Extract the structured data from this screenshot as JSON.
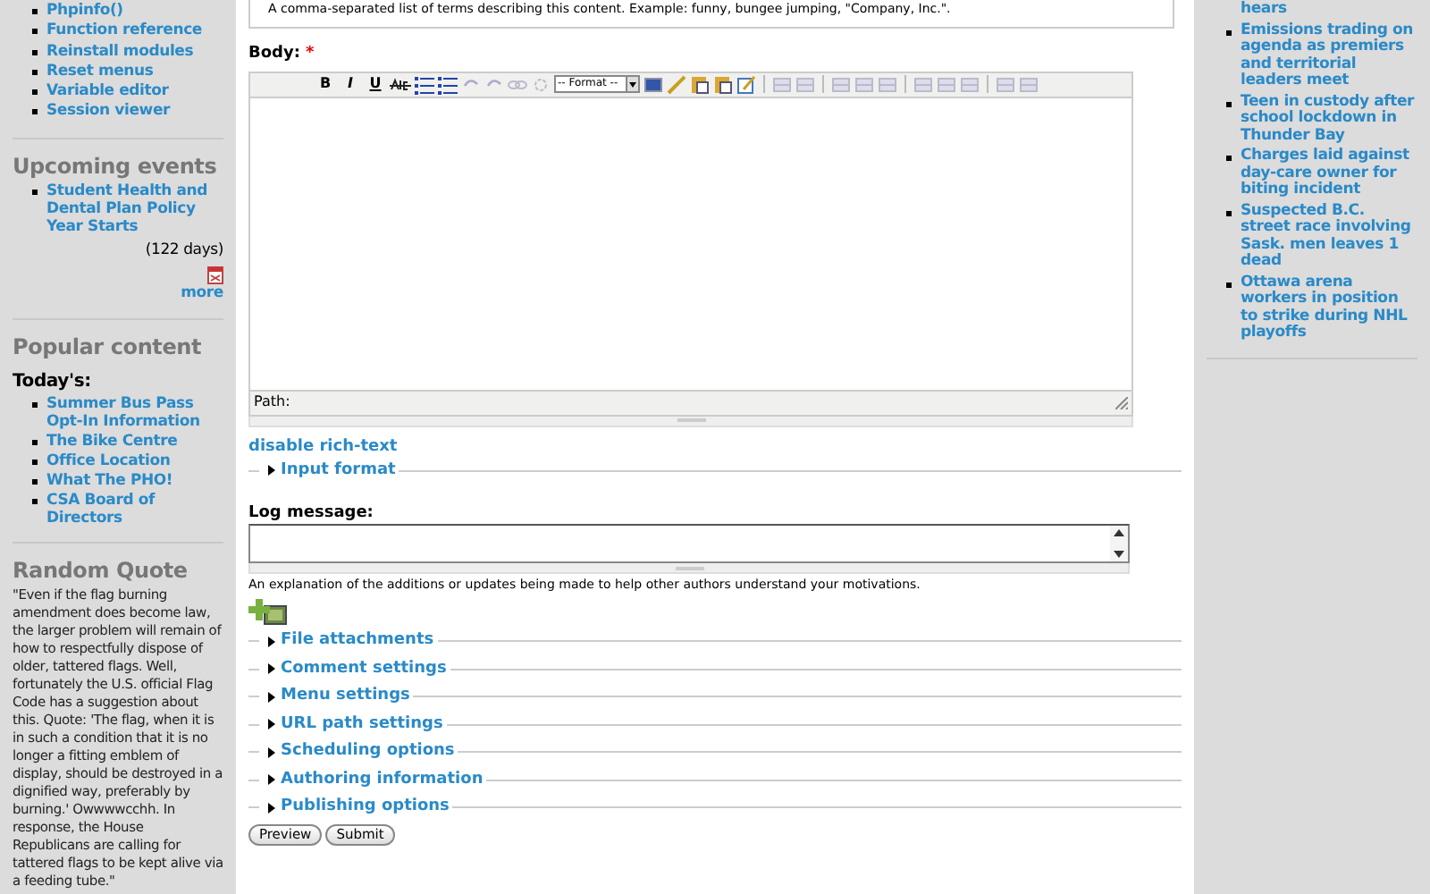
{
  "left_sidebar": {
    "admin_links": [
      "Phpinfo()",
      "Function reference",
      "Reinstall modules",
      "Reset menus",
      "Variable editor",
      "Session viewer"
    ],
    "upcoming_events": {
      "title": "Upcoming events",
      "events": [
        {
          "label": "Student Health and Dental Plan Policy Year Starts",
          "days": "(122 days)"
        }
      ],
      "more": "more"
    },
    "popular_content": {
      "title": "Popular content",
      "subtitle": "Today's:",
      "items": [
        "Summer Bus Pass Opt-In Information",
        "The Bike Centre",
        "Office Location",
        "What The PHO!",
        "CSA Board of Directors"
      ]
    },
    "random_quote": {
      "title": "Random Quote",
      "text": "\"Even if the flag burning amendment does become law, the larger problem will remain of how to respectfully dispose of older, tattered flags. Well, fortunately the U.S. official Flag Code has a suggestion about this. Quote: 'The flag, when it is in such a condition that it is no longer a fitting emblem of display, should be destroyed in a dignified way, preferably by burning.' Owwwwcchh. In response, the House Republicans are calling for tattered flags to be kept alive via a feeding tube.\""
    }
  },
  "main": {
    "tags_description": "A comma-separated list of terms describing this content. Example: funny, bungee jumping, \"Company, Inc.\".",
    "body": {
      "label": "Body:",
      "required_mark": "*",
      "style_buttons": [
        "B",
        "I",
        "U"
      ],
      "format_select": "-- Format --",
      "path_label": "Path:"
    },
    "disable_rich_text": "disable rich-text",
    "input_format": {
      "label": "Input format",
      "expanded": false
    },
    "log_message": {
      "label": "Log message:",
      "description": "An explanation of the additions or updates being made to help other authors understand your motivations."
    },
    "fieldsets": [
      {
        "label": "File attachments",
        "expanded": false
      },
      {
        "label": "Comment settings",
        "expanded": false
      },
      {
        "label": "Menu settings",
        "expanded": false
      },
      {
        "label": "URL path settings",
        "expanded": false
      },
      {
        "label": "Scheduling options",
        "expanded": false
      },
      {
        "label": "Authoring information",
        "expanded": false
      },
      {
        "label": "Publishing options",
        "expanded": false
      }
    ],
    "buttons": [
      "Preview",
      "Submit"
    ]
  },
  "right_sidebar": {
    "news": [
      "hears",
      "Emissions trading on agenda as premiers and territorial leaders meet",
      "Teen in custody after school lockdown in Thunder Bay",
      "Charges laid against day-care owner for biting incident",
      "Suspected B.C. street race involving Sask. men leaves 1 dead",
      "Ottawa arena workers in position to strike during NHL playoffs"
    ]
  }
}
